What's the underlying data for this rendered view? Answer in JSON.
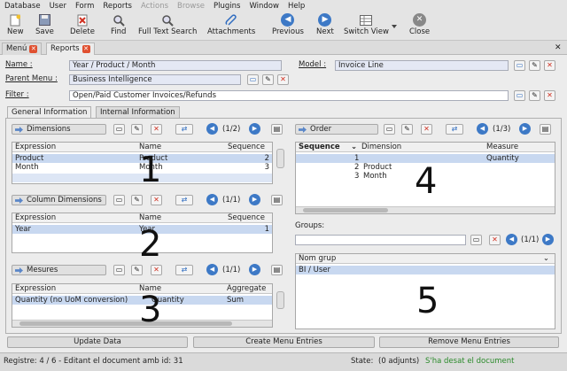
{
  "menubar": {
    "items": [
      "Database",
      "User",
      "Form",
      "Reports",
      "Actions",
      "Browse",
      "Plugins",
      "Window",
      "Help"
    ],
    "disabled": [
      "Actions",
      "Browse"
    ]
  },
  "toolbar": {
    "new": "New",
    "save": "Save",
    "delete": "Delete",
    "find": "Find",
    "fulltext": "Full Text Search",
    "attachments": "Attachments",
    "previous": "Previous",
    "next": "Next",
    "switch_view": "Switch View",
    "close": "Close"
  },
  "doc_tabs": {
    "menu": "Menú",
    "reports": "Reports"
  },
  "form": {
    "name_label": "Name :",
    "name_value": "Year / Product / Month",
    "model_label": "Model :",
    "model_value": "Invoice Line",
    "parent_label": "Parent Menu :",
    "parent_value": "Business Intelligence",
    "filter_label": "Filter :",
    "filter_value": "Open/Paid Customer Invoices/Refunds"
  },
  "inner_tabs": {
    "general": "General Information",
    "internal": "Internal Information"
  },
  "dimensions": {
    "title": "Dimensions",
    "counter": "(1/2)",
    "headers": [
      "Expression",
      "Name",
      "Sequence"
    ],
    "rows": [
      {
        "expression": "Product",
        "name": "Product",
        "sequence": "2"
      },
      {
        "expression": "Month",
        "name": "Month",
        "sequence": "3"
      }
    ]
  },
  "column_dimensions": {
    "title": "Column Dimensions",
    "counter": "(1/1)",
    "headers": [
      "Expression",
      "Name",
      "Sequence"
    ],
    "rows": [
      {
        "expression": "Year",
        "name": "Year",
        "sequence": "1"
      }
    ]
  },
  "measures": {
    "title": "Mesures",
    "counter": "(1/1)",
    "headers": [
      "Expression",
      "Name",
      "Aggregate"
    ],
    "rows": [
      {
        "expression": "Quantity (no UoM conversion)",
        "name": "Quantity",
        "aggregate": "Sum"
      }
    ]
  },
  "order": {
    "title": "Order",
    "counter": "(1/3)",
    "headers": [
      "Sequence",
      "Dimension",
      "Measure"
    ],
    "rows": [
      {
        "sequence": "1",
        "dimension": "",
        "measure": "Quantity"
      },
      {
        "sequence": "2",
        "dimension": "Product",
        "measure": ""
      },
      {
        "sequence": "3",
        "dimension": "Month",
        "measure": ""
      }
    ]
  },
  "groups": {
    "label": "Groups:",
    "counter": "(1/1)",
    "header": "Nom grup",
    "rows": [
      "BI / User"
    ]
  },
  "annotations": [
    "1",
    "2",
    "3",
    "4",
    "5"
  ],
  "bottom_buttons": {
    "update": "Update Data",
    "create": "Create Menu Entries",
    "remove": "Remove Menu Entries"
  },
  "status": {
    "left": "Registre: 4 / 6 - Editant el document amb id: 31",
    "state_label": "State:",
    "attachments": "(0 adjunts)",
    "saved": "S'ha desat el document"
  },
  "colors": {
    "accent": "#3d79c6",
    "selected_row": "#c8d8f0",
    "field_bg": "#e4e8f4",
    "saved_text": "#2a8a2a"
  }
}
